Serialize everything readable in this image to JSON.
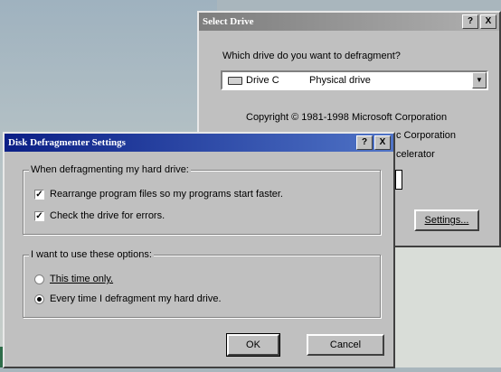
{
  "select_drive": {
    "title": "Select Drive",
    "help_btn": "?",
    "close_btn": "X",
    "question": "Which drive do you want to defragment?",
    "drive": {
      "name": "Drive C",
      "type": "Physical drive"
    },
    "copyright_1": "Copyright © 1981-1998 Microsoft Corporation",
    "copyright_2": "c Corporation",
    "copyright_3": "celerator",
    "settings_button": "Settings..."
  },
  "settings_dialog": {
    "title": "Disk Defragmenter Settings",
    "help_btn": "?",
    "close_btn": "X",
    "group1_label": "When defragmenting my hard drive:",
    "rearrange": {
      "label": "Rearrange program files so my programs start faster.",
      "checked": true
    },
    "check_errors": {
      "label": "Check the drive for errors.",
      "checked": true
    },
    "group2_label": "I want to use these options:",
    "this_time": {
      "label": "This time only.",
      "selected": false
    },
    "every_time": {
      "label": "Every time I defragment my hard drive.",
      "selected": true
    },
    "ok_label": "OK",
    "cancel_label": "Cancel"
  }
}
